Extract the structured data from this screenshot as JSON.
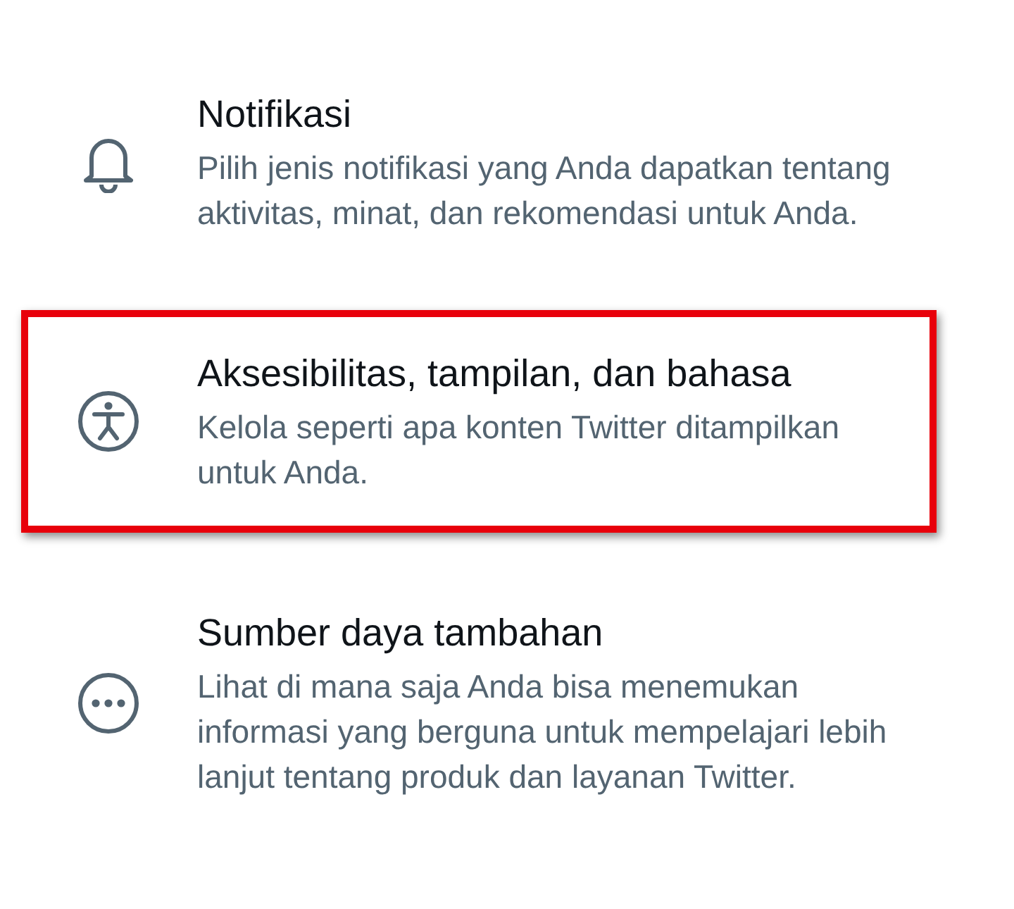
{
  "settings_items": [
    {
      "kind": "bell",
      "title": "Notifikasi",
      "description": "Pilih jenis notifikasi yang Anda dapatkan tentang aktivitas, minat, dan rekomendasi untuk Anda.",
      "highlighted": false
    },
    {
      "kind": "accessibility",
      "title": "Aksesibilitas, tampilan, dan bahasa",
      "description": "Kelola seperti apa konten Twitter ditampilkan untuk Anda.",
      "highlighted": true
    },
    {
      "kind": "more",
      "title": "Sumber daya tambahan",
      "description": "Lihat di mana saja Anda bisa menemukan informasi yang berguna untuk mempelajari lebih lanjut tentang produk dan layanan Twitter.",
      "highlighted": false
    }
  ]
}
